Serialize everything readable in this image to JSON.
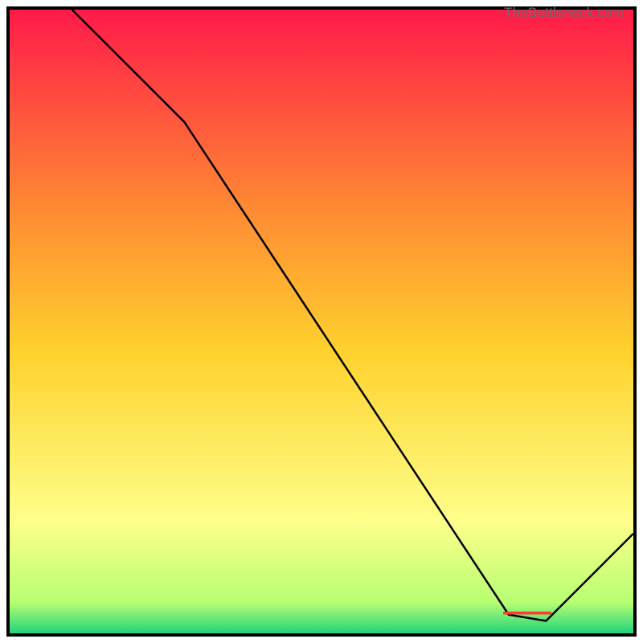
{
  "attribution": "TheBottleneck.com",
  "chart_data": {
    "type": "line",
    "title": "",
    "xlabel": "",
    "ylabel": "",
    "xlim": [
      0,
      100
    ],
    "ylim": [
      0,
      100
    ],
    "attribution": "TheBottleneck.com",
    "gradient": {
      "top": "#ff1a49",
      "upper_mid": "#ff8a33",
      "mid": "#ffd22e",
      "lower_mid": "#feff8a",
      "near_bottom": "#b7ff72",
      "bottom": "#23d37b"
    },
    "series": [
      {
        "name": "bottleneck-curve",
        "color": "#000000",
        "points": [
          {
            "x": 10,
            "y": 100
          },
          {
            "x": 28,
            "y": 82
          },
          {
            "x": 80,
            "y": 3
          },
          {
            "x": 86,
            "y": 2
          },
          {
            "x": 100,
            "y": 16
          }
        ]
      }
    ],
    "annotations": [
      {
        "name": "optimum-marker",
        "text": "▬▬▬▬▬",
        "x": 83,
        "y": 3,
        "color": "#ff3a2f"
      }
    ]
  }
}
